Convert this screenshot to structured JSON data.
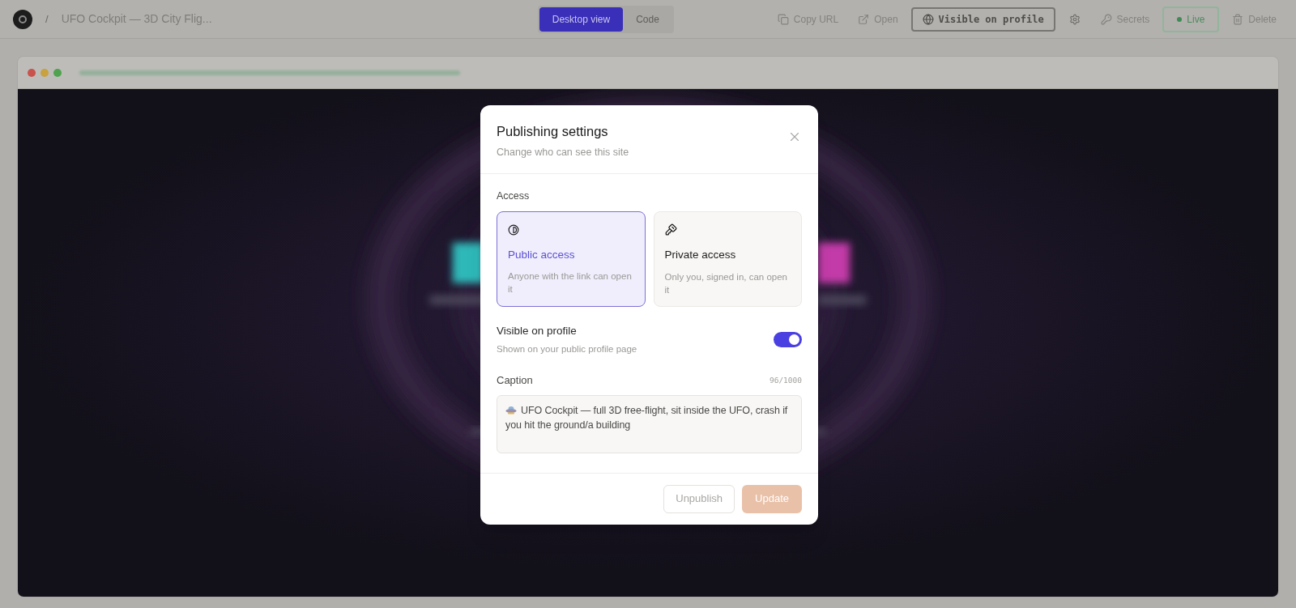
{
  "app_bar": {
    "separator": "/",
    "title": "UFO Cockpit — 3D City Flig...",
    "view_tabs": [
      {
        "label": "Desktop view",
        "selected": true
      },
      {
        "label": "Code",
        "selected": false
      }
    ],
    "actions": [
      {
        "kind": "copy",
        "label": "Copy URL"
      },
      {
        "kind": "open",
        "label": "Open"
      },
      {
        "kind": "profile",
        "label": "Visible on profile"
      },
      {
        "kind": "settings"
      },
      {
        "kind": "secrets",
        "label": "Secrets"
      },
      {
        "kind": "live",
        "label": "Live"
      },
      {
        "kind": "delete",
        "label": "Delete"
      }
    ]
  },
  "dialog": {
    "title": "Publishing settings",
    "subtitle": "Change who can see this site",
    "access_label": "Access",
    "access_options": [
      {
        "kind": "public",
        "label": "Public access",
        "description": "Anyone with the link can open it",
        "selected": true
      },
      {
        "kind": "private",
        "label": "Private access",
        "description": "Only you, signed in, can open it",
        "selected": false
      }
    ],
    "profile_toggle": {
      "label": "Visible on profile",
      "description": "Shown on your public profile page",
      "on": true
    },
    "caption": {
      "label": "Caption",
      "counter": "96/1000",
      "value": "UFO Cockpit — full 3D free-flight, sit inside the UFO, crash if you hit the ground/a building"
    },
    "buttons": [
      {
        "kind": "secondary",
        "label": "Unpublish",
        "disabled": true
      },
      {
        "kind": "primary",
        "label": "Update",
        "disabled": true
      }
    ]
  }
}
